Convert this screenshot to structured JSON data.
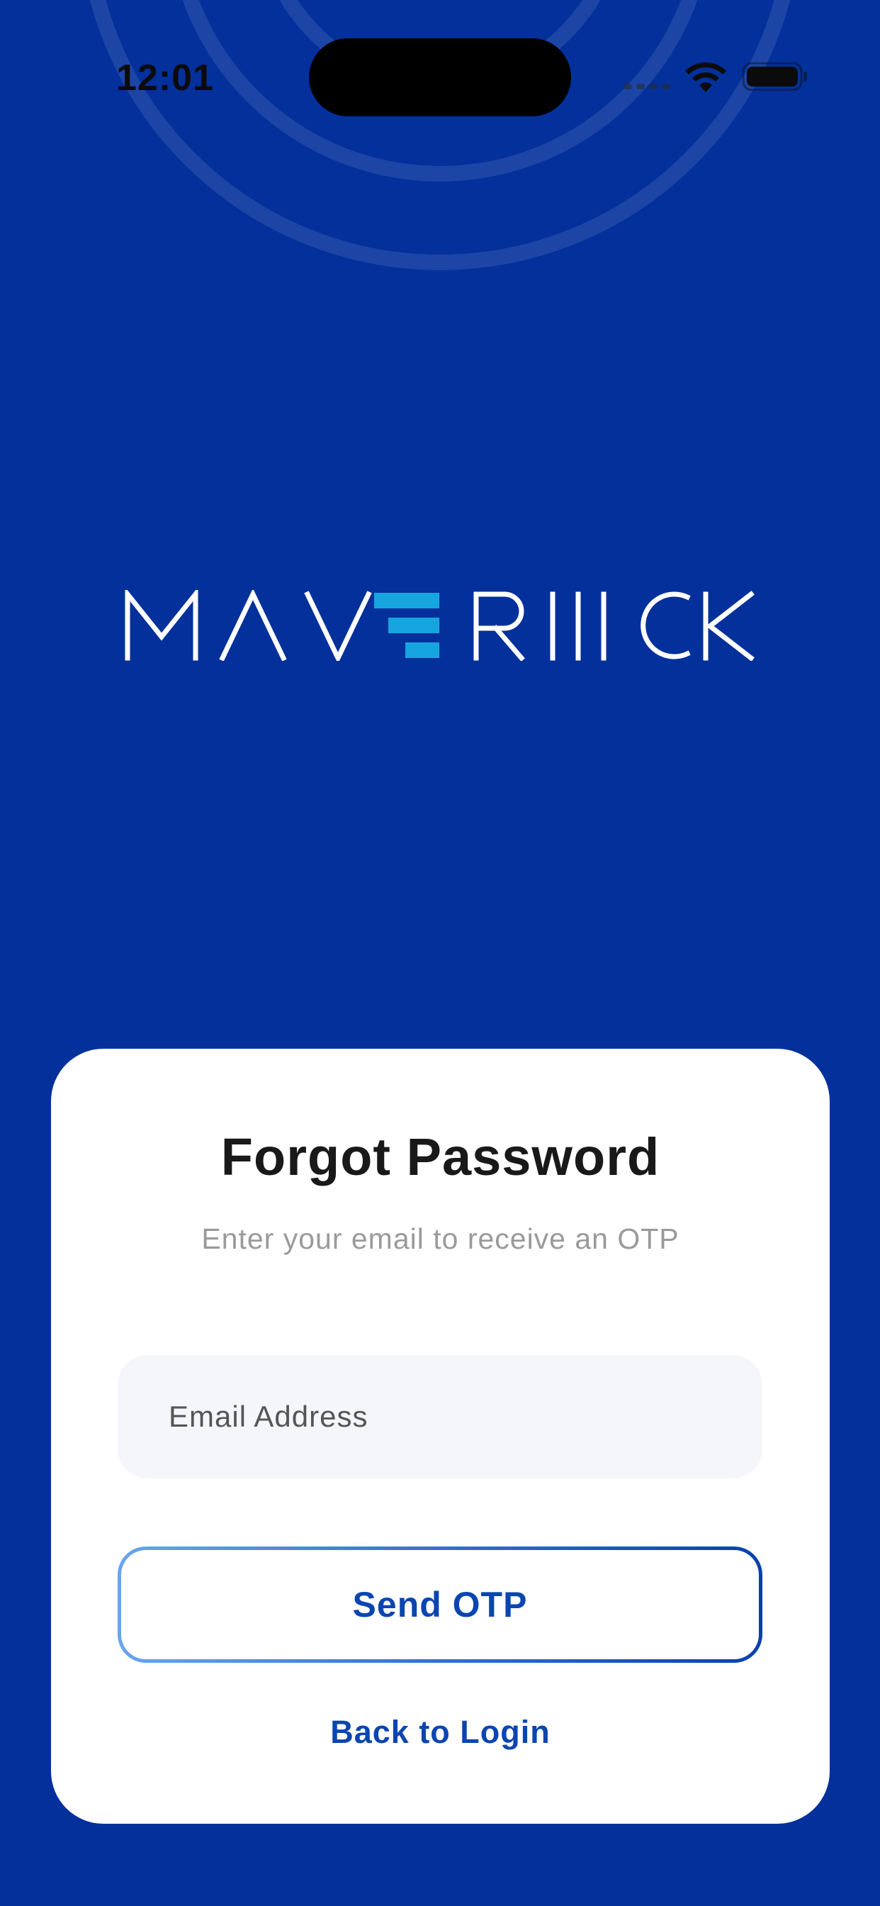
{
  "status_bar": {
    "time": "12:01",
    "icons": [
      "cell-signal-icon",
      "wifi-icon",
      "battery-icon"
    ]
  },
  "brand": {
    "logo_icon": "maverick-logo-icon",
    "logo_text": "MAVERIICK",
    "background_color": "#03309b",
    "accent_color": "#17a5df"
  },
  "card": {
    "title": "Forgot Password",
    "subtitle": "Enter your email to receive an OTP",
    "email_field": {
      "value": "",
      "placeholder": "Email Address"
    },
    "send_otp_label": "Send OTP",
    "back_to_login_label": "Back to Login",
    "link_color": "#0b46b0"
  }
}
